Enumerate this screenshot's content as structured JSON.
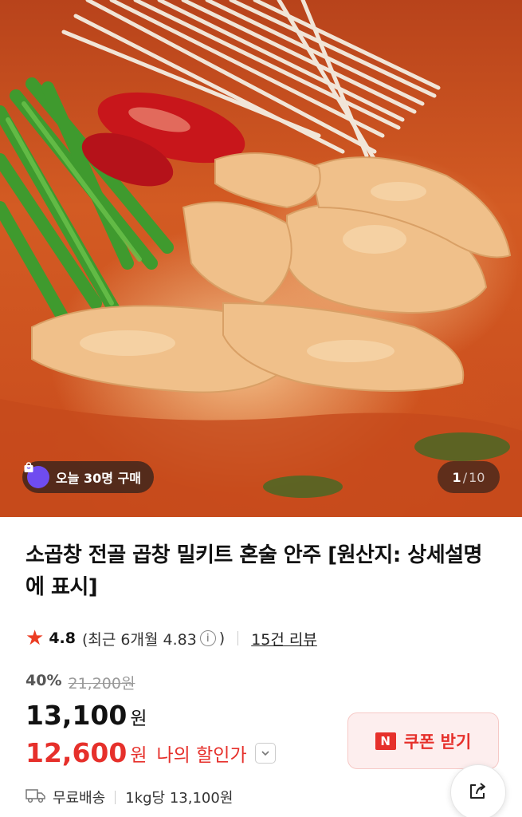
{
  "product": {
    "image": {
      "purchase_badge": "오늘 30명 구매",
      "counter": {
        "current": "1",
        "separator": "/",
        "total": "10"
      }
    },
    "title": "소곱창 전골 곱창 밀키트 혼술 안주 [원산지: 상세설명에 표시]",
    "rating": {
      "score": "4.8",
      "recent_prefix": "(최근 6개월 4.83",
      "recent_suffix": ")",
      "info_glyph": "i",
      "reviews": "15건 리뷰"
    },
    "pricing": {
      "discount_percent": "40%",
      "original_price": "21,200원",
      "price_amount": "13,100",
      "price_unit": "원",
      "my_price_amount": "12,600",
      "my_price_unit": "원",
      "my_price_label": "나의 할인가"
    },
    "coupon": {
      "logo": "N",
      "label": "쿠폰 받기"
    },
    "shipping": {
      "label": "무료배송",
      "unit_price": "1kg당 13,100원"
    }
  },
  "colors": {
    "accent_red": "#e6302b",
    "star": "#ec3d23",
    "badge_bag": "#6f4cf0"
  },
  "icons": [
    "shopping-bag-icon",
    "star-icon",
    "info-icon",
    "chevron-down-icon",
    "truck-icon",
    "share-icon"
  ]
}
